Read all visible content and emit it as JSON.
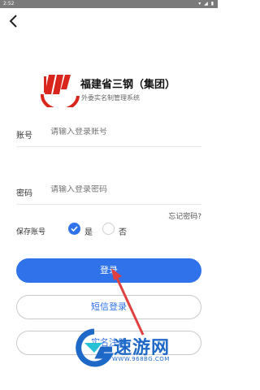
{
  "status_bar": {
    "time": "2:52",
    "icons": "▾ ◢ ▮"
  },
  "brand": {
    "title": "福建省三钢（集团）",
    "subtitle": "外委实名制管理系统"
  },
  "form": {
    "account_label": "账号",
    "account_placeholder": "请输入登录账号",
    "password_label": "密码",
    "password_placeholder": "请输入登录密码",
    "forgot_label": "忘记密码?",
    "save_account_label": "保存账号",
    "option_yes": "是",
    "option_no": "否",
    "save_account_selected": "是"
  },
  "buttons": {
    "login": "登录",
    "sms_login": "短信登录",
    "register": "实名注册"
  },
  "watermark": {
    "text": "速游网",
    "url": "WWW.968BG.COM"
  },
  "colors": {
    "primary": "#2f72ea",
    "brand_red": "#d9251c",
    "watermark_blue": "#1e69c7"
  }
}
